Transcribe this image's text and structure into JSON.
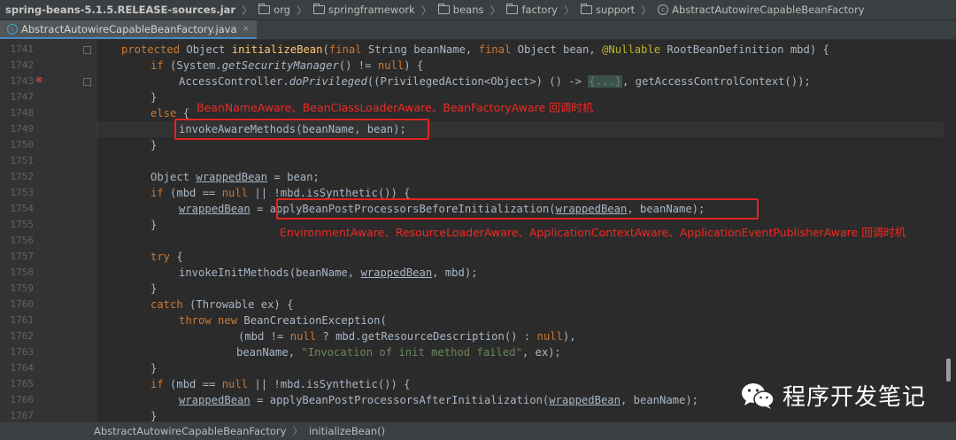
{
  "breadcrumbs": {
    "items": [
      "spring-beans-5.1.5.RELEASE-sources.jar",
      "org",
      "springframework",
      "beans",
      "factory",
      "support",
      "AbstractAutowireCapableBeanFactory"
    ],
    "separator": "〉"
  },
  "tab": {
    "label": "AbstractAutowireCapableBeanFactory.java",
    "close": "×"
  },
  "line_numbers": [
    "1741",
    "1742",
    "1743",
    "1747",
    "1748",
    "1749",
    "1750",
    "1751",
    "1752",
    "1753",
    "1754",
    "1755",
    "1756",
    "1757",
    "1758",
    "1759",
    "1760",
    "1761",
    "1762",
    "1763",
    "1764",
    "1765",
    "1766",
    "1767"
  ],
  "code": {
    "l1741": {
      "kw1": "protected ",
      "t1": "Object ",
      "m1": "initializeBean",
      "t2": "(",
      "kw2": "final ",
      "t3": "String beanName, ",
      "kw3": "final ",
      "t4": "Object bean, ",
      "ann": "@Nullable ",
      "t5": "RootBeanDefinition mbd) {"
    },
    "l1742": {
      "kw1": "if ",
      "t1": "(System.",
      "i1": "getSecurityManager",
      "t2": "() != ",
      "kw2": "null",
      "t3": ") {"
    },
    "l1743": {
      "t1": "AccessController.",
      "i1": "doPrivileged",
      "t2": "((PrivilegedAction<Object>) () -> ",
      "f1": "{...}",
      "t3": ", getAccessControlContext());"
    },
    "l1747": {
      "t1": "}"
    },
    "l1748": {
      "kw1": "else ",
      "t1": "{"
    },
    "l1749": {
      "t1": "invokeAwareMethods(beanName, bean);"
    },
    "l1750": {
      "t1": "}"
    },
    "l1752": {
      "t1": "Object ",
      "u1": "wrappedBean",
      "t2": " = bean;"
    },
    "l1753": {
      "kw1": "if ",
      "t1": "(mbd == ",
      "kw2": "null",
      "t2": " || !mbd.isSynthetic()) {"
    },
    "l1754": {
      "u1": "wrappedBean",
      "t1": " = applyBeanPostProcessorsBeforeInitialization(",
      "u2": "wrappedBean",
      "t2": ", beanName);"
    },
    "l1755": {
      "t1": "}"
    },
    "l1757": {
      "kw1": "try ",
      "t1": "{"
    },
    "l1758": {
      "t1": "invokeInitMethods(beanName, ",
      "u1": "wrappedBean",
      "t2": ", mbd);"
    },
    "l1759": {
      "t1": "}"
    },
    "l1760": {
      "kw1": "catch ",
      "t1": "(Throwable ex) {"
    },
    "l1761": {
      "kw1": "throw new ",
      "t1": "BeanCreationException("
    },
    "l1762": {
      "t1": "(mbd != ",
      "kw1": "null ",
      "t2": "? mbd.getResourceDescription() : ",
      "kw2": "null",
      "t3": "),"
    },
    "l1763": {
      "t1": "beanName, ",
      "s1": "\"Invocation of init method failed\"",
      "t2": ", ex);"
    },
    "l1764": {
      "t1": "}"
    },
    "l1765": {
      "kw1": "if ",
      "t1": "(mbd == ",
      "kw2": "null",
      "t2": " || !mbd.isSynthetic()) {"
    },
    "l1766": {
      "u1": "wrappedBean",
      "t1": " = applyBeanPostProcessorsAfterInitialization(",
      "u2": "wrappedBean",
      "t2": ", beanName);"
    },
    "l1767": {
      "t1": "}"
    }
  },
  "annotations": {
    "aware1": "BeanNameAware、BeanClassLoaderAware、BeanFactoryAware 回调时机",
    "aware2": "EnvironmentAware、ResourceLoaderAware、ApplicationContextAware、ApplicationEventPublisherAware 回调时机"
  },
  "statusbar": {
    "class_name": "AbstractAutowireCapableBeanFactory",
    "method_name": "initializeBean()"
  },
  "watermark": {
    "text": "程序开发笔记"
  },
  "colors": {
    "keyword": "#cc7832",
    "method": "#ffc66d",
    "annotation": "#bbb529",
    "string": "#6a8759",
    "text": "#a9b7c6",
    "highlight_box": "#e3241f",
    "annotation_text": "#f02a22"
  }
}
